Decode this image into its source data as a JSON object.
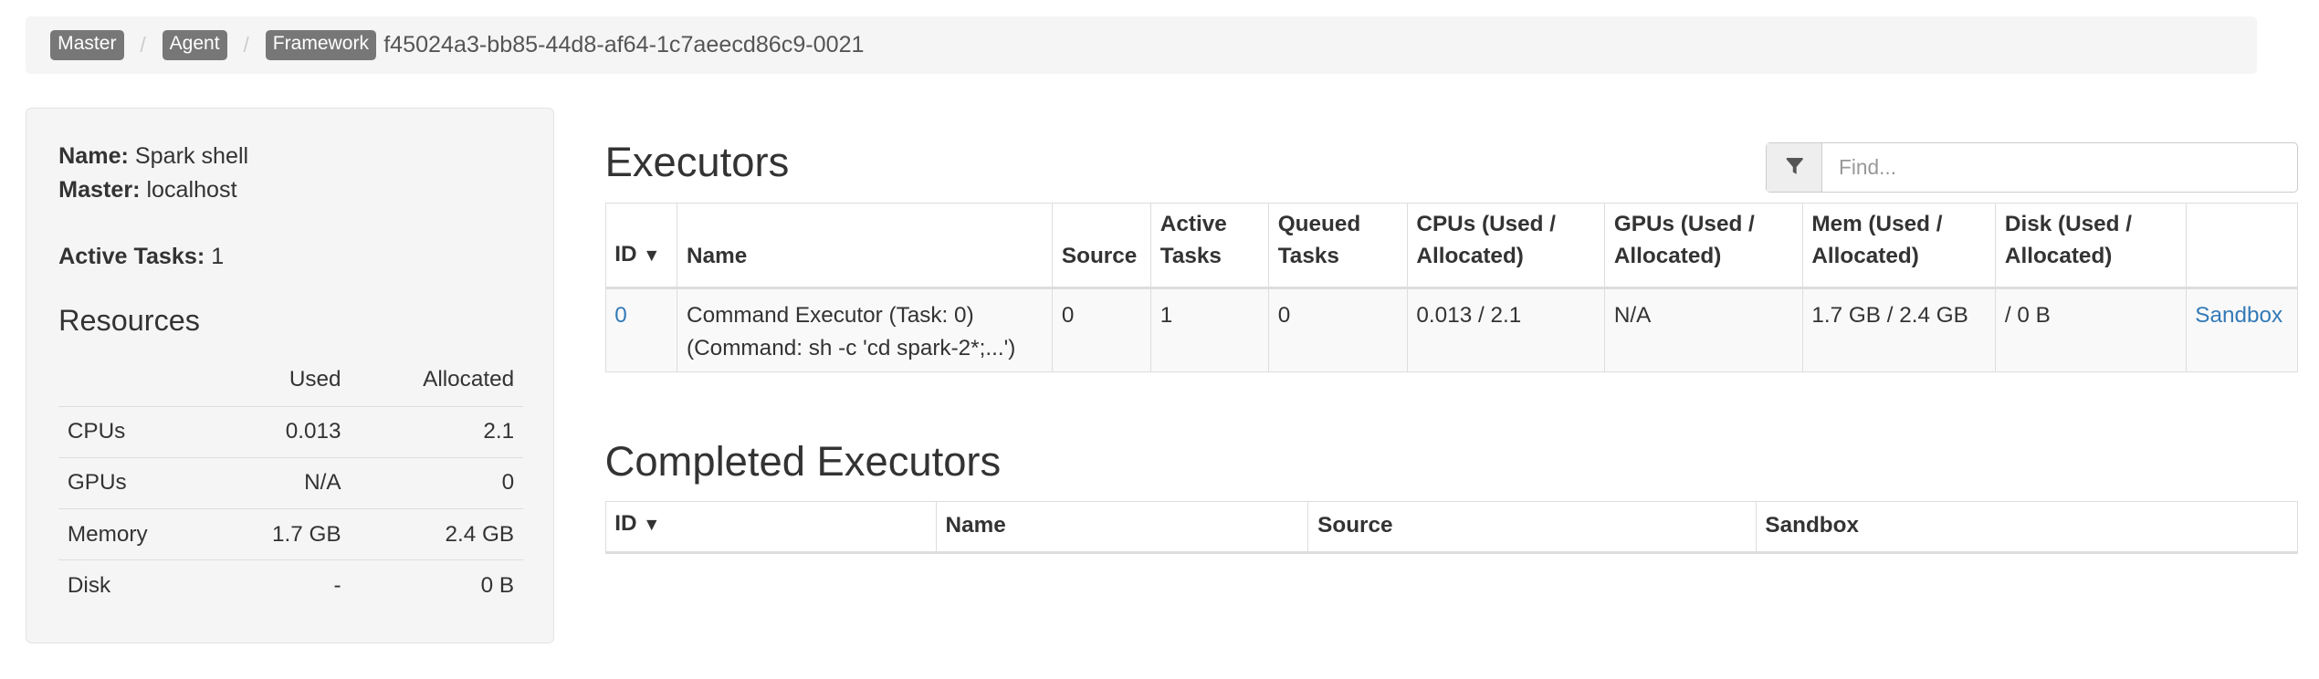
{
  "breadcrumb": {
    "items": [
      "Master",
      "Agent",
      "Framework"
    ],
    "framework_id": "f45024a3-bb85-44d8-af64-1c7aeecd86c9-0021"
  },
  "info": {
    "name_label": "Name:",
    "name_value": "Spark shell",
    "master_label": "Master:",
    "master_value": "localhost",
    "active_tasks_label": "Active Tasks:",
    "active_tasks_value": "1"
  },
  "resources": {
    "title": "Resources",
    "headers": [
      "",
      "Used",
      "Allocated"
    ],
    "rows": [
      {
        "name": "CPUs",
        "used": "0.013",
        "allocated": "2.1"
      },
      {
        "name": "GPUs",
        "used": "N/A",
        "allocated": "0"
      },
      {
        "name": "Memory",
        "used": "1.7 GB",
        "allocated": "2.4 GB"
      },
      {
        "name": "Disk",
        "used": "-",
        "allocated": "0 B"
      }
    ]
  },
  "executors": {
    "title": "Executors",
    "filter": {
      "placeholder": "Find...",
      "icon": "filter-icon"
    },
    "sort_indicator": "▼",
    "headers": {
      "id": "ID",
      "name": "Name",
      "source": "Source",
      "active_tasks_1": "Active",
      "active_tasks_2": "Tasks",
      "queued_tasks_1": "Queued",
      "queued_tasks_2": "Tasks",
      "cpus_1": "CPUs (Used /",
      "cpus_2": "Allocated)",
      "gpus_1": "GPUs (Used /",
      "gpus_2": "Allocated)",
      "mem_1": "Mem (Used /",
      "mem_2": "Allocated)",
      "disk_1": "Disk (Used /",
      "disk_2": "Allocated)"
    },
    "rows": [
      {
        "id": "0",
        "name_1": "Command Executor (Task: 0)",
        "name_2": "(Command: sh -c 'cd spark-2*;...')",
        "source": "0",
        "active_tasks": "1",
        "queued_tasks": "0",
        "cpus": "0.013 / 2.1",
        "gpus": "N/A",
        "mem": "1.7 GB / 2.4 GB",
        "disk": "/ 0 B",
        "sandbox": "Sandbox"
      }
    ]
  },
  "completed_executors": {
    "title": "Completed Executors",
    "headers": {
      "id": "ID",
      "name": "Name",
      "source": "Source",
      "sandbox": "Sandbox"
    }
  }
}
